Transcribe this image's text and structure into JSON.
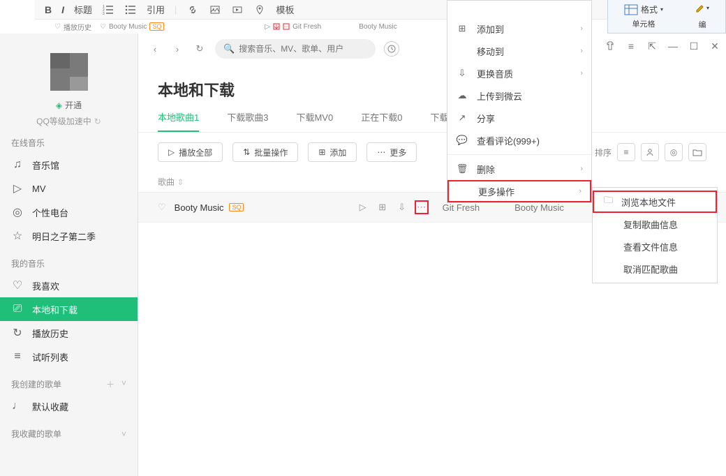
{
  "outerToolbar": {
    "bold": "B",
    "italic": "I",
    "heading": "标题",
    "quote": "引用",
    "template": "模板"
  },
  "ribbon": {
    "format": "格式",
    "cells": "单元格",
    "bian": "编"
  },
  "browserTabs": [
    "播放历史",
    "Booty Music",
    "Git Fresh",
    "Booty Music"
  ],
  "sidebar": {
    "open": "开通",
    "qq_line": "QQ等级加速中",
    "groups": {
      "online": "在线音乐",
      "mine": "我的音乐",
      "created": "我创建的歌单",
      "favs": "我收藏的歌单"
    },
    "onlineItems": [
      "音乐馆",
      "MV",
      "个性电台",
      "明日之子第二季"
    ],
    "mineItems": [
      "我喜欢",
      "本地和下载",
      "播放历史",
      "试听列表"
    ],
    "default_fav": "默认收藏"
  },
  "search": {
    "placeholder": "搜索音乐、MV、歌单、用户"
  },
  "pageTitle": "本地和下载",
  "tabs": [
    "本地歌曲1",
    "下载歌曲3",
    "下载MV0",
    "正在下载0",
    "下载历史"
  ],
  "buttons": {
    "playAll": "播放全部",
    "batch": "批量操作",
    "add": "添加",
    "more": "更多"
  },
  "sortLabel": "排序",
  "tableHead": {
    "song": "歌曲"
  },
  "song": {
    "title": "Booty Music",
    "artist": "Git Fresh",
    "album": "Booty Music",
    "badge": "SQ"
  },
  "contextMenu": {
    "addTo": "添加到",
    "moveTo": "移动到",
    "quality": "更换音质",
    "upload": "上传到微云",
    "share": "分享",
    "comments": "查看评论(999+)",
    "delete": "删除",
    "moreOps": "更多操作"
  },
  "submenu": {
    "browseLocal": "浏览本地文件",
    "copyInfo": "复制歌曲信息",
    "fileInfo": "查看文件信息",
    "unmatch": "取消匹配歌曲"
  }
}
